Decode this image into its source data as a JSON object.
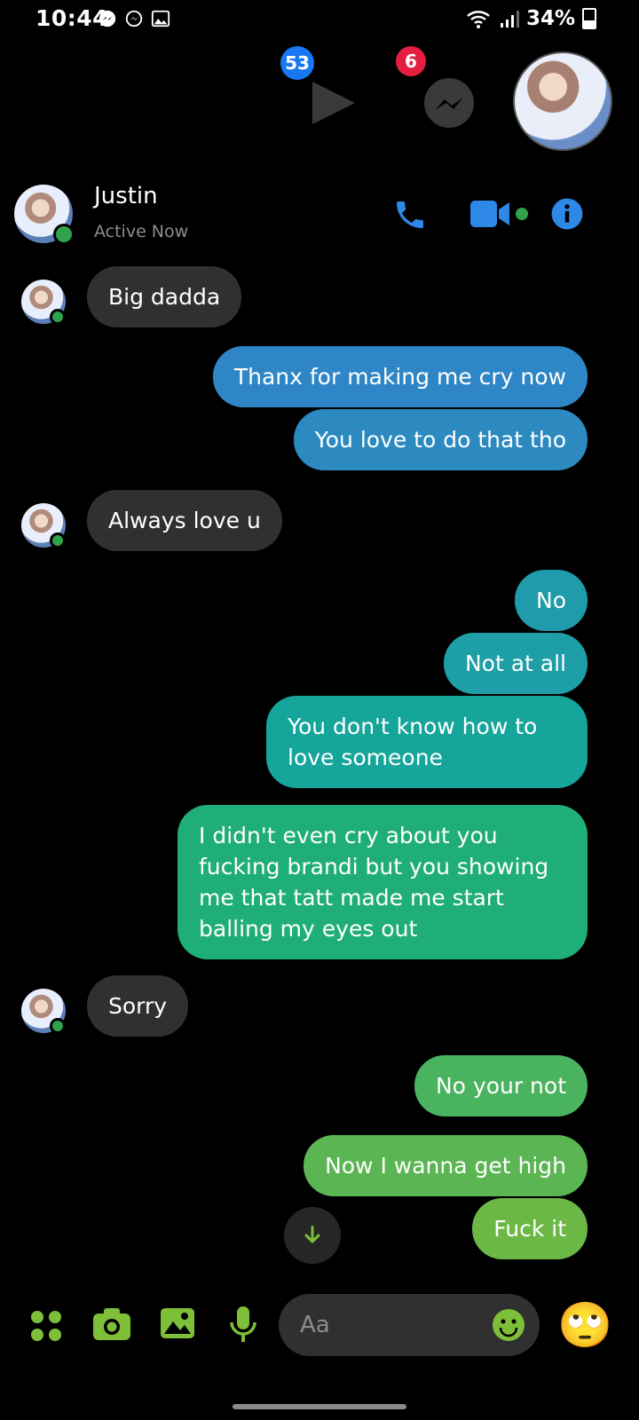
{
  "status_bar": {
    "time": "10:44",
    "battery": "34%",
    "icons": [
      "messenger-notification-icon",
      "messenger-notification-icon",
      "gallery-notification-icon",
      "wifi-icon",
      "signal-icon",
      "battery-icon"
    ]
  },
  "chat_heads": {
    "video_badge": "53",
    "messenger_badge": "6"
  },
  "header": {
    "name": "Justin",
    "status": "Active Now",
    "actions": [
      "phone-icon",
      "video-icon",
      "info-icon"
    ]
  },
  "messages": [
    {
      "from": "them",
      "text": "Big dadda"
    },
    {
      "from": "me",
      "text": "Thanx for making me cry now"
    },
    {
      "from": "me",
      "text": "You love to do that tho"
    },
    {
      "from": "them",
      "text": "Always love u"
    },
    {
      "from": "me",
      "text": "No"
    },
    {
      "from": "me",
      "text": "Not at all"
    },
    {
      "from": "me",
      "text": "You don't know how to love someone"
    },
    {
      "from": "me",
      "text": "I didn't even cry about you fucking brandi but you showing me that tatt made me start balling my eyes out"
    },
    {
      "from": "them",
      "text": "Sorry"
    },
    {
      "from": "me",
      "text": "No your not"
    },
    {
      "from": "me",
      "text": "Now I wanna get high"
    },
    {
      "from": "me",
      "text": "Fuck it"
    }
  ],
  "composer": {
    "placeholder": "Aa",
    "quick_reaction": "🙄"
  },
  "colors": {
    "accent_blue": "#2d88e6",
    "accent_green": "#7ebf3a",
    "online": "#31a24c",
    "incoming_bubble": "#303030"
  }
}
